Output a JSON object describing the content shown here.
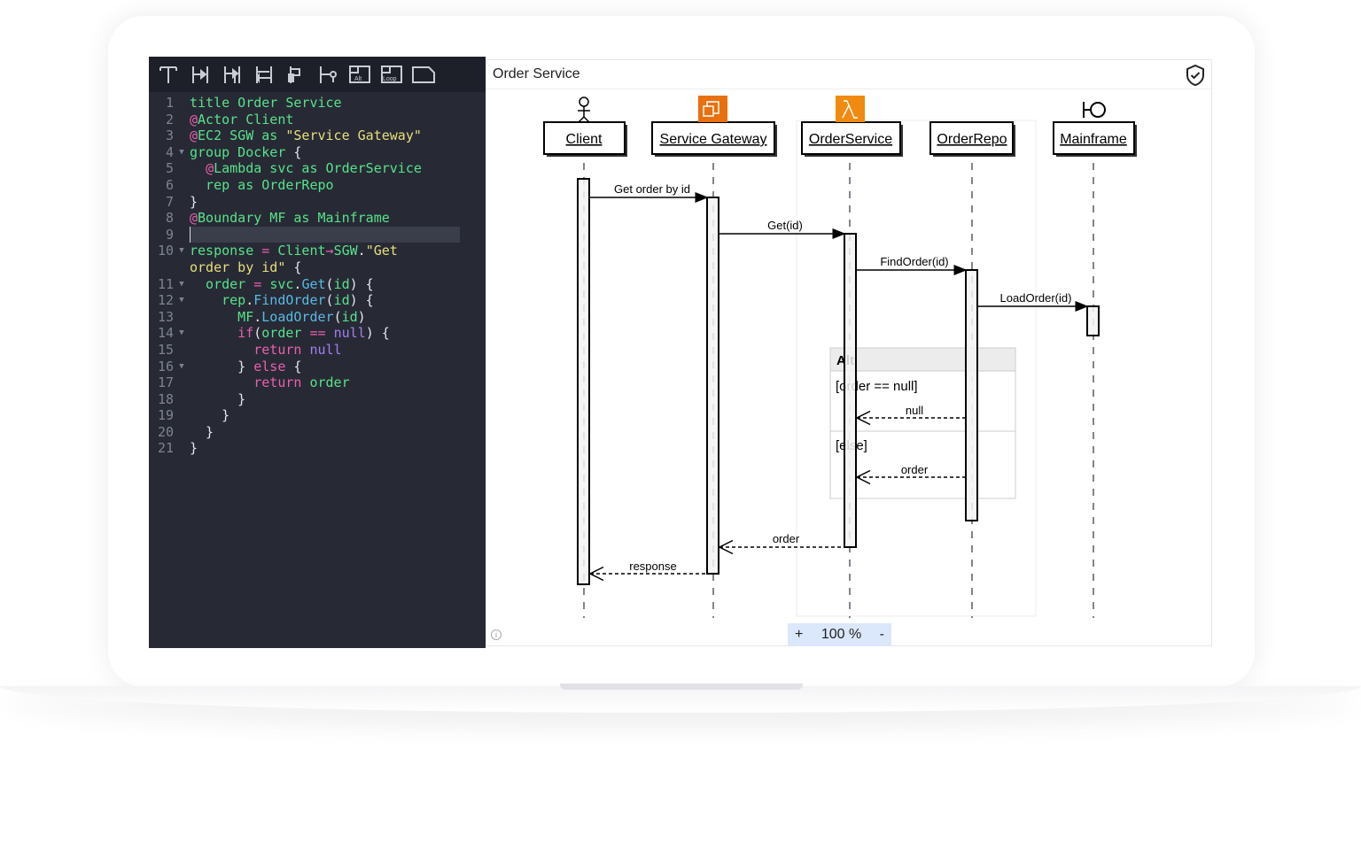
{
  "editor": {
    "toolbar": [
      "title-tool",
      "sync-message-tool",
      "async-message-tool",
      "return-message-tool",
      "self-message-tool",
      "lost-message-tool",
      "alt-fragment-tool",
      "loop-fragment-tool",
      "note-tool"
    ],
    "toolbar_labels": {
      "alt": "Alt",
      "loop": "Loop"
    },
    "lines": [
      {
        "n": "1",
        "fold": false,
        "t": [
          [
            "title Order Service",
            "g"
          ]
        ]
      },
      {
        "n": "2",
        "fold": false,
        "t": [
          [
            "@",
            "p"
          ],
          [
            "Actor Client",
            "g"
          ]
        ]
      },
      {
        "n": "3",
        "fold": false,
        "t": [
          [
            "@",
            "p"
          ],
          [
            "EC2 SGW as ",
            "g"
          ],
          [
            "\"Service Gateway\"",
            "y"
          ]
        ]
      },
      {
        "n": "4",
        "fold": true,
        "t": [
          [
            "group Docker ",
            "g"
          ],
          [
            "{",
            "w"
          ]
        ]
      },
      {
        "n": "5",
        "fold": false,
        "t": [
          [
            "  ",
            "w"
          ],
          [
            "@",
            "p"
          ],
          [
            "Lambda svc as OrderService",
            "g"
          ]
        ]
      },
      {
        "n": "6",
        "fold": false,
        "t": [
          [
            "  rep as OrderRepo",
            "g"
          ]
        ]
      },
      {
        "n": "7",
        "fold": false,
        "t": [
          [
            "}",
            "w"
          ]
        ]
      },
      {
        "n": "8",
        "fold": false,
        "t": [
          [
            "@",
            "p"
          ],
          [
            "Boundary MF as Mainframe",
            "g"
          ]
        ]
      },
      {
        "n": "9",
        "fold": false,
        "active": true,
        "t": [
          [
            "",
            "w"
          ]
        ]
      },
      {
        "n": "10",
        "fold": true,
        "t": [
          [
            "response ",
            "g"
          ],
          [
            "= ",
            "p"
          ],
          [
            "Client",
            "g"
          ],
          [
            "→",
            "p"
          ],
          [
            "SGW",
            "g"
          ],
          [
            ".",
            "w"
          ],
          [
            "\"Get",
            "y"
          ]
        ]
      },
      {
        "n": "",
        "fold": false,
        "t": [
          [
            "order by id\" ",
            "y"
          ],
          [
            "{",
            "w"
          ]
        ]
      },
      {
        "n": "11",
        "fold": true,
        "t": [
          [
            "  order ",
            "g"
          ],
          [
            "= ",
            "p"
          ],
          [
            "svc",
            "g"
          ],
          [
            ".",
            "w"
          ],
          [
            "Get",
            "c"
          ],
          [
            "(",
            "w"
          ],
          [
            "id",
            "g"
          ],
          [
            ") {",
            "w"
          ]
        ]
      },
      {
        "n": "12",
        "fold": true,
        "t": [
          [
            "    rep",
            "g"
          ],
          [
            ".",
            "w"
          ],
          [
            "FindOrder",
            "c"
          ],
          [
            "(",
            "w"
          ],
          [
            "id",
            "g"
          ],
          [
            ") {",
            "w"
          ]
        ]
      },
      {
        "n": "13",
        "fold": false,
        "t": [
          [
            "      MF",
            "g"
          ],
          [
            ".",
            "w"
          ],
          [
            "LoadOrder",
            "c"
          ],
          [
            "(",
            "w"
          ],
          [
            "id",
            "g"
          ],
          [
            ")",
            "w"
          ]
        ]
      },
      {
        "n": "14",
        "fold": true,
        "t": [
          [
            "      if",
            "p"
          ],
          [
            "(",
            "w"
          ],
          [
            "order ",
            "g"
          ],
          [
            "== ",
            "p"
          ],
          [
            "null",
            "v"
          ],
          [
            ") {",
            "w"
          ]
        ]
      },
      {
        "n": "15",
        "fold": false,
        "t": [
          [
            "        return ",
            "p"
          ],
          [
            "null",
            "v"
          ]
        ]
      },
      {
        "n": "16",
        "fold": true,
        "t": [
          [
            "      } ",
            "w"
          ],
          [
            "else ",
            "p"
          ],
          [
            "{",
            "w"
          ]
        ]
      },
      {
        "n": "17",
        "fold": false,
        "t": [
          [
            "        return ",
            "p"
          ],
          [
            "order",
            "g"
          ]
        ]
      },
      {
        "n": "18",
        "fold": false,
        "t": [
          [
            "      }",
            "w"
          ]
        ]
      },
      {
        "n": "19",
        "fold": false,
        "t": [
          [
            "    }",
            "w"
          ]
        ]
      },
      {
        "n": "20",
        "fold": false,
        "t": [
          [
            "  }",
            "w"
          ]
        ]
      },
      {
        "n": "21",
        "fold": false,
        "t": [
          [
            "}",
            "w"
          ]
        ]
      }
    ]
  },
  "diagram": {
    "title": "Order Service",
    "participants": [
      {
        "label": "Client",
        "icon": "actor-icon"
      },
      {
        "label": "Service Gateway",
        "icon": "ec2-icon",
        "color": "#e8700f"
      },
      {
        "label": "OrderService",
        "icon": "lambda-icon",
        "color": "#f08a10"
      },
      {
        "label": "OrderRepo"
      },
      {
        "label": "Mainframe",
        "icon": "boundary-icon"
      }
    ],
    "messages": [
      "Get order by id",
      "Get(id)",
      "FindOrder(id)",
      "LoadOrder(id)",
      "null",
      "order",
      "order",
      "response"
    ],
    "alt": {
      "label": "Alt",
      "cond1": "[order == null]",
      "cond2": "[else]"
    },
    "zoom": {
      "in": "+",
      "level": "100 %",
      "out": "-"
    }
  }
}
